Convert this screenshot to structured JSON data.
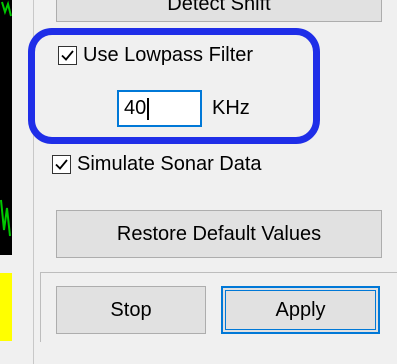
{
  "top_button": {
    "label": "Detect Shift"
  },
  "lowpass": {
    "checkbox_label": "Use Lowpass Filter",
    "checked": true,
    "frequency_value": "40",
    "unit": "KHz"
  },
  "sonar": {
    "checkbox_label": "Simulate Sonar Data",
    "checked": true
  },
  "buttons": {
    "restore_label": "Restore Default Values",
    "stop_label": "Stop",
    "apply_label": "Apply"
  },
  "colors": {
    "highlight": "#1f2ee8",
    "focus": "#0078d7",
    "scope_trace": "#00c800",
    "scope_yellow": "#ffff00"
  }
}
